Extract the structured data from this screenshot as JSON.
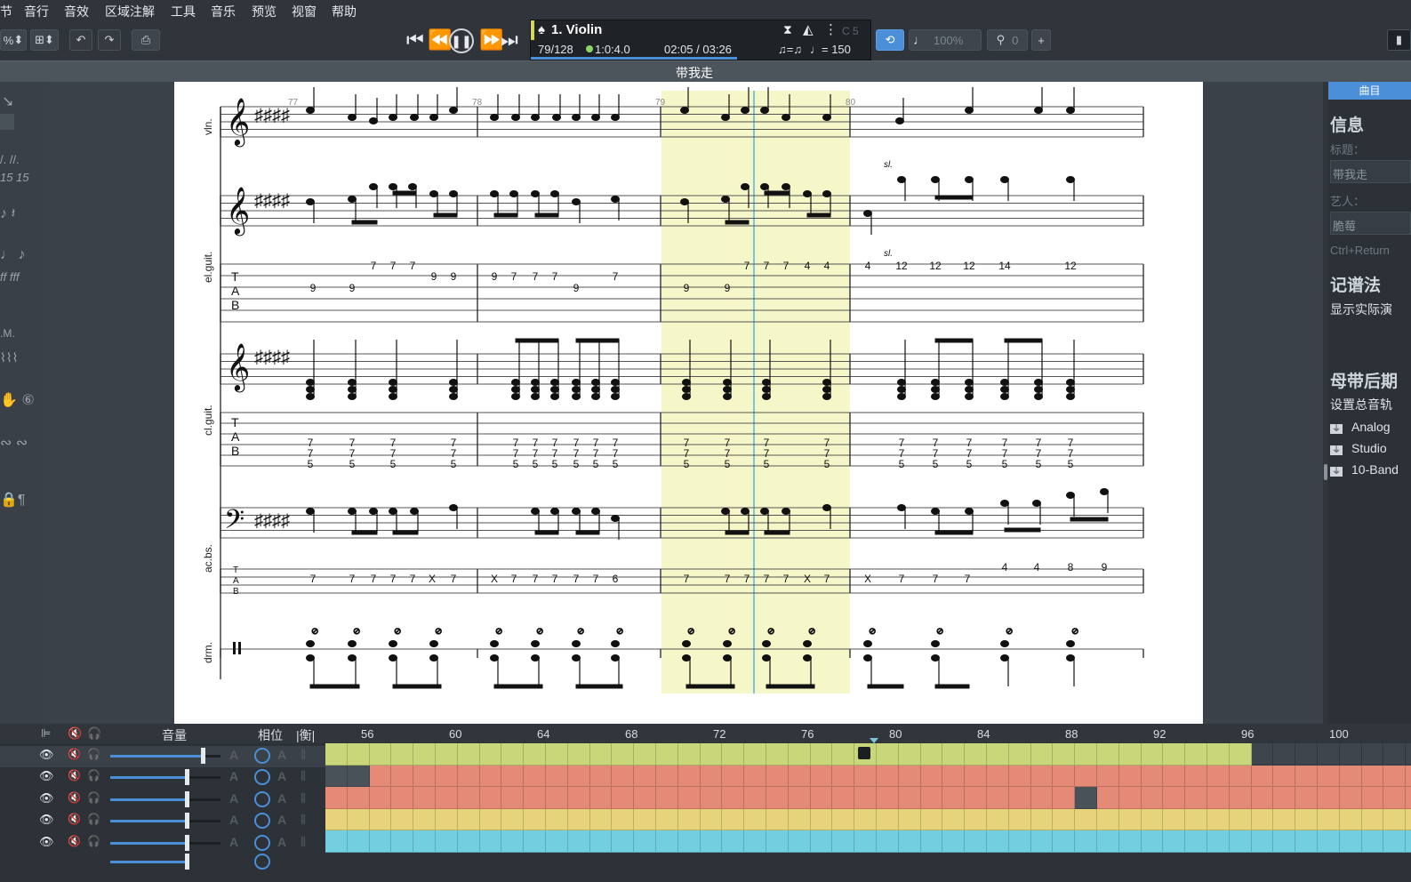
{
  "menu": [
    "节",
    "音行",
    "音效",
    "区域注解",
    "工具",
    "音乐",
    "预览",
    "视窗",
    "帮助"
  ],
  "toolbar": {
    "zoom_text": "%",
    "undo_icon": "undo-icon",
    "redo_icon": "redo-icon",
    "print_icon": "print-icon"
  },
  "lcd": {
    "track": "1. Violin",
    "bar_position": "79/128",
    "beat": "1:0:4.0",
    "time": "02:05 / 03:26",
    "swing": "♫=♫",
    "tempo": "♩= 150",
    "key": "C 5"
  },
  "right_toolbar": {
    "zoom": "100%",
    "counter": "0"
  },
  "document_title": "带我走",
  "score": {
    "bar_numbers": [
      "77",
      "78",
      "79",
      "80"
    ],
    "track_labels": [
      "vln.",
      "el.guit.",
      "cl.guit.",
      "ac.bs.",
      "drm."
    ],
    "slide_mark": "sl.",
    "tab_letters": [
      "T",
      "A",
      "B"
    ],
    "tab_frets": {
      "elguit_bar77": [
        "9",
        "9",
        "7",
        "7",
        "7",
        "9",
        "9"
      ],
      "elguit_bar78": [
        "9",
        "7",
        "7",
        "7",
        "9",
        "7"
      ],
      "elguit_bar79": [
        "9",
        "9",
        "7",
        "7",
        "7",
        "4",
        "4"
      ],
      "elguit_bar80": [
        "4",
        "12",
        "12",
        "12",
        "14",
        "12"
      ],
      "clguit_top": [
        "7",
        "7",
        "7",
        "7"
      ],
      "acbs_bar77": [
        "7",
        "7",
        "7",
        "7",
        "7",
        "X",
        "7"
      ],
      "acbs_bar78": [
        "X",
        "7",
        "7",
        "7",
        "7",
        "7",
        "6"
      ],
      "acbs_bar79": [
        "7",
        "7",
        "7",
        "7",
        "7",
        "X",
        "7"
      ],
      "acbs_bar80": [
        "X",
        "7",
        "7",
        "7",
        "4",
        "4",
        "8",
        "9"
      ]
    }
  },
  "right_panel": {
    "tab": "曲目",
    "info_heading": "信息",
    "title_label": "标题：",
    "title_value": "带我走",
    "artist_label": "艺人：",
    "artist_value": "脆莓",
    "hint": "Ctrl+Return",
    "notation_heading": "记谱法",
    "notation_text": "显示实际演",
    "master_heading": "母带后期",
    "master_text": "设置总音轨",
    "plugins": [
      "Analog",
      "Studio",
      "10-Band"
    ]
  },
  "mixer": {
    "volume_label": "音量",
    "pan_label": "相位",
    "balance_label": "|衡|",
    "bar_numbers": [
      "56",
      "60",
      "64",
      "68",
      "72",
      "76",
      "80",
      "84",
      "88",
      "92",
      "96",
      "100"
    ],
    "track_colors": [
      "#c9d77a",
      "#e58a76",
      "#e58a76",
      "#e6d37a",
      "#71cfe0"
    ]
  },
  "colors": {
    "highlight": "#f5f7c8",
    "cursor": "#7fc4de",
    "accent_blue": "#4a8fd8"
  }
}
